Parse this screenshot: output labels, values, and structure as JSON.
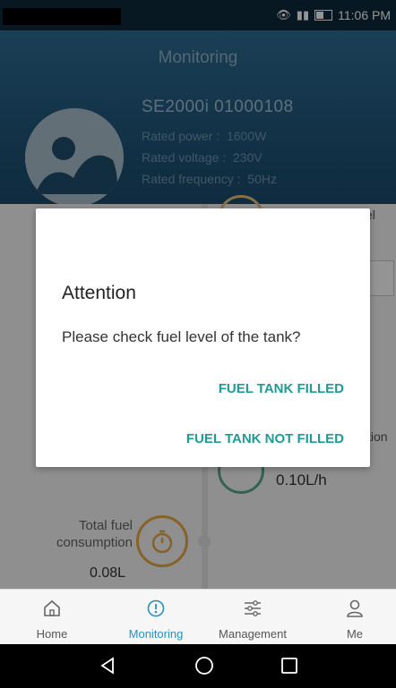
{
  "status_bar": {
    "time": "11:06 PM"
  },
  "header": {
    "title": "Monitoring",
    "device_name": "SE2000i  01000108",
    "rated_power": "Rated power :  1600W",
    "rated_voltage": "Rated voltage :  230V",
    "rated_frequency": "Rated frequency :  50Hz"
  },
  "background_content": {
    "fuel_rate": "0.10L/h",
    "total_fuel_label_line1": "Total fuel",
    "total_fuel_label_line2": "consumption",
    "total_fuel_value": "0.08L",
    "right_cut_top": "el",
    "right_cut_mid": "tion"
  },
  "dialog": {
    "title": "Attention",
    "message": "Please check fuel level of the tank?",
    "button_filled": "FUEL TANK FILLED",
    "button_not_filled": "FUEL TANK NOT FILLED"
  },
  "bottom_nav": {
    "items": [
      {
        "label": "Home",
        "icon": "home-icon",
        "active": false
      },
      {
        "label": "Monitoring",
        "icon": "monitoring-icon",
        "active": true
      },
      {
        "label": "Management",
        "icon": "sliders-icon",
        "active": false
      },
      {
        "label": "Me",
        "icon": "person-icon",
        "active": false
      }
    ]
  },
  "colors": {
    "accent_teal": "#1d9b94",
    "active_blue": "#2a8fbe",
    "header_blue": "#21587d"
  }
}
